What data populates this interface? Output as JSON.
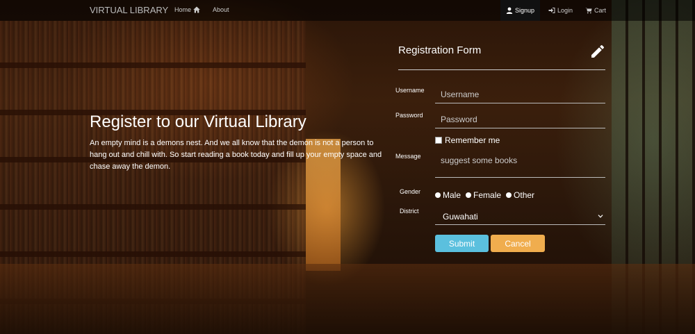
{
  "navbar": {
    "brand": "VIRTUAL LIBRARY",
    "home": "Home",
    "about": "About",
    "signup": "Signup",
    "login": "Login",
    "cart": "Cart"
  },
  "hero": {
    "title": "Register to our Virtual Library",
    "text": "An empty mind is a demons nest. And we all know that the demon is not a person to hang out and chill with. So start reading a book today and fill up your empty space and chase away the demon."
  },
  "form": {
    "title": "Registration Form",
    "username_label": "Username",
    "username_placeholder": "Username",
    "password_label": "Password",
    "password_placeholder": "Password",
    "remember": "Remember me",
    "message_label": "Message",
    "message_placeholder": "suggest some books",
    "gender_label": "Gender",
    "gender_options": [
      "Male",
      "Female",
      "Other"
    ],
    "district_label": "District",
    "district_value": "Guwahati",
    "submit": "Submit",
    "cancel": "Cancel"
  },
  "colors": {
    "submit": "#5bc0de",
    "cancel": "#f0ad4e"
  }
}
